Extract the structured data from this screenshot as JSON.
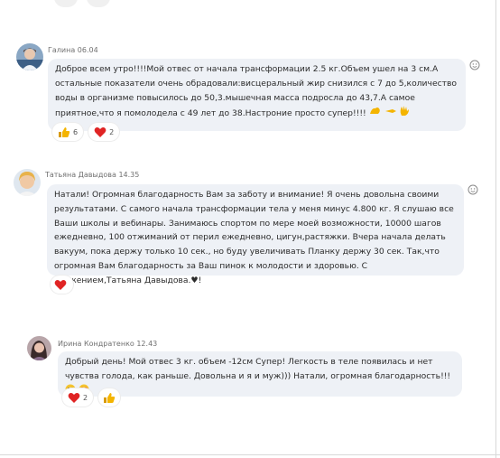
{
  "messages": [
    {
      "author": "Галина",
      "time": "06.04",
      "text": "Доброе всем утро!!!!Мой отвес от начала трансформации 2.5 кг.Объем ушел на 3 см.А остальные показатели очень обрадовали:висцеральный жир снизился с 7 до 5,количество воды в организме повысилось до 50,3.мышечная масса подросла до 43,7.А самое приятное,что я помолодела с 49 лет до 38.Настроние просто супер!!!!",
      "reactions": [
        {
          "icon": "thumbs-up-icon",
          "count": "6"
        },
        {
          "icon": "heart-icon",
          "count": "2"
        }
      ]
    },
    {
      "author": "Татьяна Давыдова",
      "time": "14.35",
      "text": "Натали! Огромная благодарность Вам за заботу и внимание! Я очень довольна  своими результатами. С самого начала трансформации тела у меня минус 4.800 кг. Я слушаю все Ваши школы и вебинары. Занимаюсь спортом по мере моей возможности, 10000 шагов ежедневно, 100 отжиманий от перил ежедневно, цигун,растяжки. Вчера начала делать вакуум, пока держу только 10 сек., но буду увеличивать Планку держу 30 сек. Так,что огромная Вам благодарность за Ваш пинок к молодости и здоровью. С уважением,Татьяна Давыдова.♥!",
      "reactions": [
        {
          "icon": "heart-icon",
          "count": ""
        }
      ]
    },
    {
      "author": "Ирина Кондратенко",
      "time": "12.43",
      "text": "Добрый день! Мой отвес 3 кг.  объем -12см Супер! Легкость в теле появилась и нет чувства голода, как раньше. Довольна и я и муж))) Натали, огромная благодарность!!! ",
      "reactions": [
        {
          "icon": "heart-icon",
          "count": "2"
        },
        {
          "icon": "thumbs-up-icon",
          "count": ""
        }
      ]
    }
  ],
  "colors": {
    "bubble": "#eef1f6",
    "heart": "#e02424",
    "thumb": "#f4b400",
    "meta": "#707070"
  }
}
